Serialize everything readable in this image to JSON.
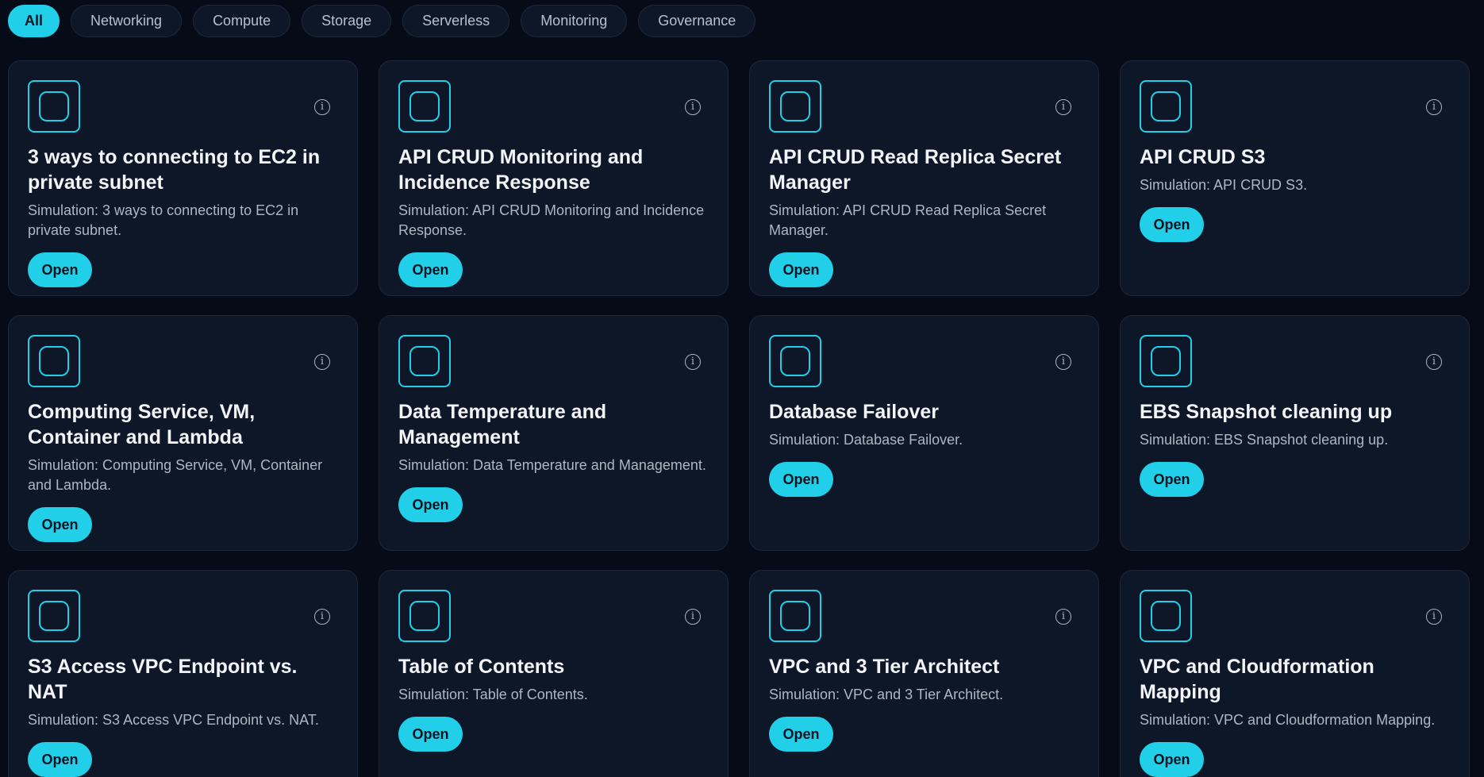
{
  "filters": [
    "All",
    "Networking",
    "Compute",
    "Storage",
    "Serverless",
    "Monitoring",
    "Governance"
  ],
  "active_filter": "All",
  "info_glyph": "i",
  "cards": [
    {
      "title": "3 ways to connecting to EC2 in private subnet",
      "description": "Simulation: 3 ways to connecting to EC2 in private subnet.",
      "button": "Open"
    },
    {
      "title": "API CRUD Monitoring and Incidence Response",
      "description": "Simulation: API CRUD Monitoring and Incidence Response.",
      "button": "Open"
    },
    {
      "title": "API CRUD Read Replica Secret Manager",
      "description": "Simulation: API CRUD Read Replica Secret Manager.",
      "button": "Open"
    },
    {
      "title": "API CRUD S3",
      "description": "Simulation: API CRUD S3.",
      "button": "Open"
    },
    {
      "title": "Computing Service, VM, Container and Lambda",
      "description": "Simulation: Computing Service, VM, Container and Lambda.",
      "button": "Open"
    },
    {
      "title": "Data Temperature and Management",
      "description": "Simulation: Data Temperature and Management.",
      "button": "Open"
    },
    {
      "title": "Database Failover",
      "description": "Simulation: Database Failover.",
      "button": "Open"
    },
    {
      "title": "EBS Snapshot cleaning up",
      "description": "Simulation: EBS Snapshot cleaning up.",
      "button": "Open"
    },
    {
      "title": "S3 Access VPC Endpoint vs. NAT",
      "description": "Simulation: S3 Access VPC Endpoint vs. NAT.",
      "button": "Open"
    },
    {
      "title": "Table of Contents",
      "description": "Simulation: Table of Contents.",
      "button": "Open"
    },
    {
      "title": "VPC and 3 Tier Architect",
      "description": "Simulation: VPC and 3 Tier Architect.",
      "button": "Open"
    },
    {
      "title": "VPC and Cloudformation Mapping",
      "description": "Simulation: VPC and Cloudformation Mapping.",
      "button": "Open"
    }
  ],
  "icons": {
    "card_icon": "simulation-icon",
    "info": "info-icon"
  },
  "colors": {
    "background": "#060b18",
    "card": "#0d1727",
    "accent": "#22cfe8",
    "title": "#f2f5f8",
    "text": "#aeb6c2"
  }
}
